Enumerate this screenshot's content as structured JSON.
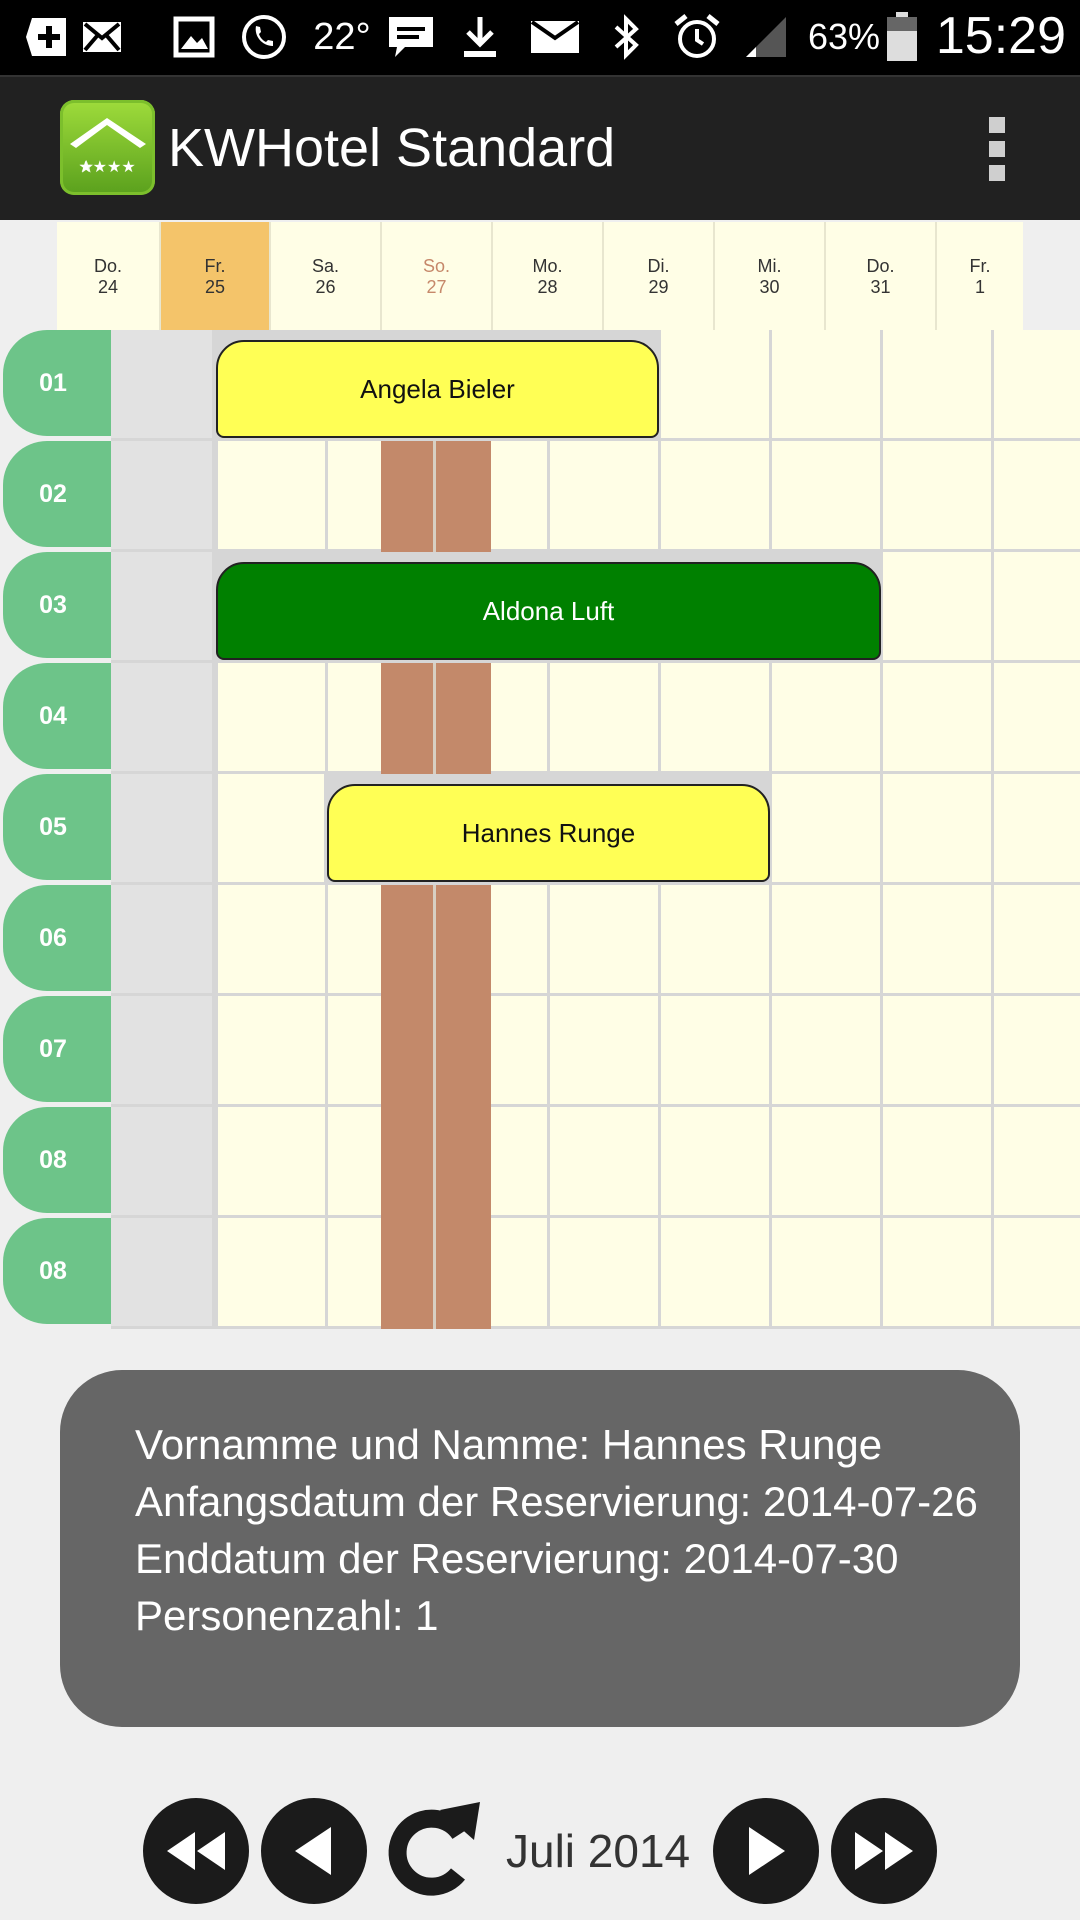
{
  "status_bar": {
    "temperature": "22°",
    "battery": "63%",
    "time": "15:29",
    "icons": [
      "add-icon",
      "sms-icon",
      "gallery-icon",
      "phone-icon",
      "chat-icon",
      "download-icon",
      "mail-icon",
      "bluetooth-icon",
      "alarm-icon",
      "signal-icon",
      "battery-icon"
    ]
  },
  "app_bar": {
    "title": "KWHotel Standard"
  },
  "dates": [
    {
      "day": "Do.",
      "num": "24"
    },
    {
      "day": "Fr.",
      "num": "25"
    },
    {
      "day": "Sa.",
      "num": "26"
    },
    {
      "day": "So.",
      "num": "27"
    },
    {
      "day": "Mo.",
      "num": "28"
    },
    {
      "day": "Di.",
      "num": "29"
    },
    {
      "day": "Mi.",
      "num": "30"
    },
    {
      "day": "Do.",
      "num": "31"
    },
    {
      "day": "Fr.",
      "num": "1"
    }
  ],
  "rooms": [
    "01",
    "02",
    "03",
    "04",
    "05",
    "06",
    "07",
    "08",
    "08"
  ],
  "reservations": [
    {
      "room_index": 0,
      "guest": "Angela Bieler",
      "color": "yellow"
    },
    {
      "room_index": 2,
      "guest": "Aldona Luft",
      "color": "green"
    },
    {
      "room_index": 4,
      "guest": "Hannes Runge",
      "color": "yellow"
    }
  ],
  "info_panel": {
    "line1": "Vornamme und Namme: Hannes Runge",
    "line2": "Anfangsdatum der Reservierung: 2014-07-26",
    "line3": "Enddatum der Reservierung: 2014-07-30",
    "line4": "Personenzahl: 1"
  },
  "nav": {
    "month": "Juli 2014"
  },
  "colors": {
    "room_label": "#6dc489",
    "today": "#f4c46a",
    "sunday": "#c3896a",
    "cell": "#fffee6",
    "reservation_yellow": "#ffff55",
    "reservation_green": "#008000"
  }
}
